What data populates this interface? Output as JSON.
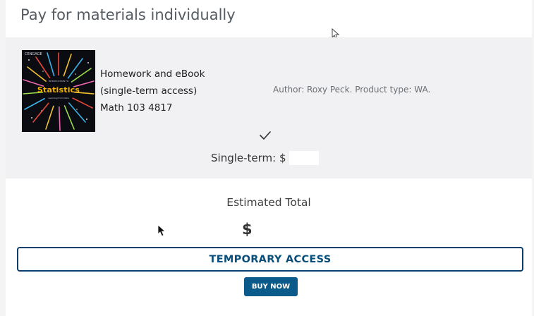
{
  "header": {
    "title": "Pay for materials individually"
  },
  "product": {
    "name_lines": [
      "Homework and eBook",
      "(single-term access)",
      "Math 103 4817"
    ],
    "meta": "Author: Roxy Peck. Product type: WA.",
    "price_label": "Single-term: $",
    "cover": {
      "brand": "CENGAGE",
      "top_text": "INTRODUCTION TO",
      "title": "Statistics",
      "subtitle": "Learning from Data"
    }
  },
  "summary": {
    "estimated_label": "Estimated Total",
    "currency_symbol": "$"
  },
  "actions": {
    "temporary_access": "TEMPORARY ACCESS",
    "buy_now": "BUY NOW"
  },
  "colors": {
    "accent": "#0a5a8a",
    "panel_bg": "#f1f1f3",
    "outline": "#0a3f6d"
  },
  "icons": {
    "check": "check-icon",
    "cursor": "mouse-pointer-icon"
  }
}
